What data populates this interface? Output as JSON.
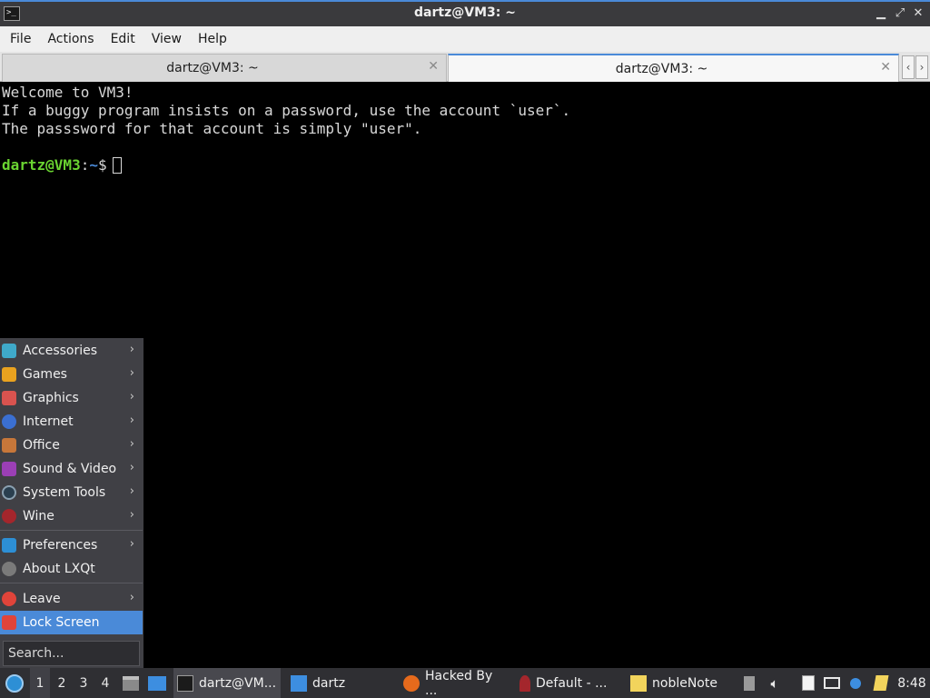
{
  "window": {
    "title": "dartz@VM3: ~",
    "app_icon_glyph": ">_",
    "minimize_glyph": "▁",
    "maximize_glyph": "⤢",
    "close_glyph": "✕"
  },
  "menubar": {
    "items": [
      {
        "label": "File"
      },
      {
        "label": "Actions"
      },
      {
        "label": "Edit"
      },
      {
        "label": "View"
      },
      {
        "label": "Help"
      }
    ]
  },
  "tabs": {
    "items": [
      {
        "label": "dartz@VM3: ~",
        "active": false
      },
      {
        "label": "dartz@VM3: ~",
        "active": true
      }
    ],
    "close_glyph": "✕",
    "scroll_left_glyph": "‹",
    "scroll_right_glyph": "›"
  },
  "terminal": {
    "lines": [
      "Welcome to VM3!",
      "If a buggy program insists on a password, use the account `user`.",
      "The passsword for that account is simply \"user\"."
    ],
    "prompt": {
      "user_host": "dartz@VM3",
      "separator": ":",
      "path": "~",
      "symbol": "$"
    }
  },
  "app_menu": {
    "items": [
      {
        "label": "Accessories",
        "icon": "accessories-icon",
        "color": "#3fa9c9",
        "has_submenu": true
      },
      {
        "label": "Games",
        "icon": "games-icon",
        "color": "#e9a21f",
        "has_submenu": true
      },
      {
        "label": "Graphics",
        "icon": "graphics-icon",
        "color": "#d9534f",
        "has_submenu": true
      },
      {
        "label": "Internet",
        "icon": "internet-icon",
        "color": "#3b6fd1",
        "has_submenu": true
      },
      {
        "label": "Office",
        "icon": "office-icon",
        "color": "#c7773a",
        "has_submenu": true
      },
      {
        "label": "Sound & Video",
        "icon": "sound-video-icon",
        "color": "#9b3fb5",
        "has_submenu": true
      },
      {
        "label": "System Tools",
        "icon": "system-tools-icon",
        "color": "#2a3f4f",
        "has_submenu": true
      },
      {
        "label": "Wine",
        "icon": "wine-icon",
        "color": "#a4262c",
        "has_submenu": true
      },
      {
        "label": "Preferences",
        "icon": "preferences-icon",
        "color": "#2d8fd5",
        "has_submenu": true
      },
      {
        "label": "About LXQt",
        "icon": "info-icon",
        "color": "#7a7a7a",
        "has_submenu": false
      },
      {
        "label": "Leave",
        "icon": "power-icon",
        "color": "#e0443a",
        "has_submenu": true
      },
      {
        "label": "Lock Screen",
        "icon": "lock-icon",
        "color": "#e0443a",
        "has_submenu": false,
        "highlighted": true
      }
    ],
    "submenu_glyph": "›",
    "search_placeholder": "Search..."
  },
  "taskbar": {
    "desktops": [
      "1",
      "2",
      "3",
      "4"
    ],
    "current_desktop": "1",
    "tasks": [
      {
        "label": "dartz@VM...",
        "icon": "terminal-icon",
        "color": "#1b1b1b"
      },
      {
        "label": "dartz",
        "icon": "folder-icon",
        "color": "#3d8ee0"
      },
      {
        "label": "Hacked By ...",
        "icon": "firefox-icon",
        "color": "#e66a1c"
      },
      {
        "label": "Default - ...",
        "icon": "wine-glass-icon",
        "color": "#a4262c"
      },
      {
        "label": "nobleNote",
        "icon": "note-icon",
        "color": "#f2d45c"
      }
    ],
    "clock": "8:48",
    "colors": {
      "accent": "#4a8ad8",
      "panel": "#2f2f33"
    }
  }
}
